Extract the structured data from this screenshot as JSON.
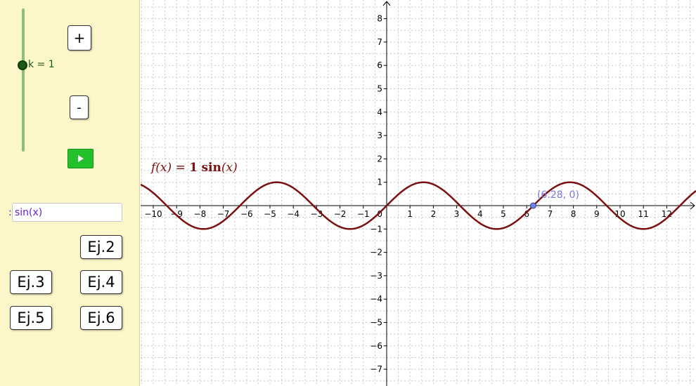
{
  "slider": {
    "label": "k = 1",
    "value": 1
  },
  "buttons": {
    "plus": "+",
    "minus": "-"
  },
  "input": {
    "label": ":",
    "value": "sin(x)"
  },
  "examples": [
    "Ej.2",
    "Ej.3",
    "Ej.4",
    "Ej.5",
    "Ej.6"
  ],
  "graph": {
    "formula_name": "f(x)",
    "formula_eq": "=",
    "formula_k": "1",
    "formula_fn": "sin",
    "formula_arg": "(x)",
    "point_label": "(6.28, 0)",
    "colors": {
      "curve": "#7b1010",
      "point": "#6f84e8",
      "grid": "#c8c8c8"
    }
  },
  "chart_data": {
    "type": "line",
    "function": "sin(x)",
    "series": [
      {
        "name": "f(x) = 1 sin(x)",
        "expr": "sin(x)"
      }
    ],
    "xlim": [
      -10.4,
      12.5
    ],
    "ylim": [
      -7.8,
      8.3
    ],
    "x_ticks": [
      -10,
      -9,
      -8,
      -7,
      -6,
      -5,
      -4,
      -3,
      -2,
      -1,
      1,
      2,
      3,
      4,
      5,
      6,
      7,
      8,
      9,
      10,
      11,
      12
    ],
    "y_ticks": [
      -7,
      -6,
      -5,
      -4,
      -3,
      -2,
      -1,
      1,
      2,
      3,
      4,
      5,
      6,
      7,
      8
    ],
    "origin_label": "0",
    "point": {
      "x": 6.28,
      "y": 0
    },
    "grid": true
  }
}
